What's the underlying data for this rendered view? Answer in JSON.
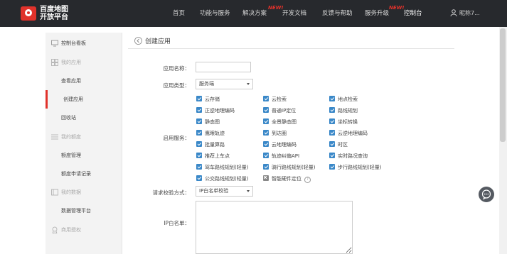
{
  "header": {
    "logo_line1": "百度地图",
    "logo_line2": "开放平台",
    "nav": [
      {
        "label": "首页"
      },
      {
        "label": "功能与服务"
      },
      {
        "label": "解决方案",
        "tag": "NEW!"
      },
      {
        "label": "开发文档"
      },
      {
        "label": "反馈与帮助"
      },
      {
        "label": "服务升级",
        "tag": "NEW!"
      },
      {
        "label": "控制台"
      }
    ],
    "user_label": "昵称7..."
  },
  "sidebar": {
    "items": [
      {
        "label": "控制台看板",
        "type": "top",
        "icon": "monitor-icon"
      },
      {
        "label": "我的应用",
        "type": "group",
        "icon": "grid-icon"
      },
      {
        "label": "查看应用",
        "type": "sub"
      },
      {
        "label": "创建应用",
        "type": "sub",
        "active": true
      },
      {
        "label": "回收站",
        "type": "sub"
      },
      {
        "label": "我的额度",
        "type": "group",
        "icon": "list-icon"
      },
      {
        "label": "额度管理",
        "type": "sub"
      },
      {
        "label": "额度申请记录",
        "type": "sub"
      },
      {
        "label": "我的数据",
        "type": "group",
        "icon": "data-icon"
      },
      {
        "label": "数据管理平台",
        "type": "sub"
      },
      {
        "label": "商用授权",
        "type": "group",
        "icon": "auth-icon"
      }
    ]
  },
  "main": {
    "title": "创建应用",
    "form": {
      "app_name_label": "应用名称：",
      "app_name_value": "",
      "app_type_label": "应用类型：",
      "app_type_value": "服务端",
      "services_label": "启用服务：",
      "services": [
        {
          "label": "云存储",
          "checked": true
        },
        {
          "label": "云检索",
          "checked": true
        },
        {
          "label": "地点检索",
          "checked": true
        },
        {
          "label": "正逆地理编码",
          "checked": true
        },
        {
          "label": "普通IP定位",
          "checked": true
        },
        {
          "label": "路线规划",
          "checked": true
        },
        {
          "label": "静态图",
          "checked": true
        },
        {
          "label": "全景静态图",
          "checked": true
        },
        {
          "label": "坐标转换",
          "checked": true
        },
        {
          "label": "鹰眼轨迹",
          "checked": true
        },
        {
          "label": "到达圈",
          "checked": true
        },
        {
          "label": "云逆地理编码",
          "checked": true
        },
        {
          "label": "批量算路",
          "checked": true
        },
        {
          "label": "云地理编码",
          "checked": true
        },
        {
          "label": "时区",
          "checked": true
        },
        {
          "label": "推荐上车点",
          "checked": true
        },
        {
          "label": "轨迹纠偏API",
          "checked": true
        },
        {
          "label": "实时路况查询",
          "checked": true
        },
        {
          "label": "驾车路线规划(轻量)",
          "checked": true
        },
        {
          "label": "骑行路线规划(轻量)",
          "checked": true
        },
        {
          "label": "步行路线规划(轻量)",
          "checked": true
        },
        {
          "label": "公交路线规划(轻量)",
          "checked": true
        },
        {
          "label": "智能硬件定位",
          "checked": false,
          "help": "?"
        }
      ],
      "verify_label": "请求校验方式：",
      "verify_value": "IP白名单校验",
      "whitelist_label": "IP白名单："
    }
  },
  "colors": {
    "topbar": "#27292d",
    "accent": "#e0322b",
    "checkbox": "#3a88c8"
  }
}
